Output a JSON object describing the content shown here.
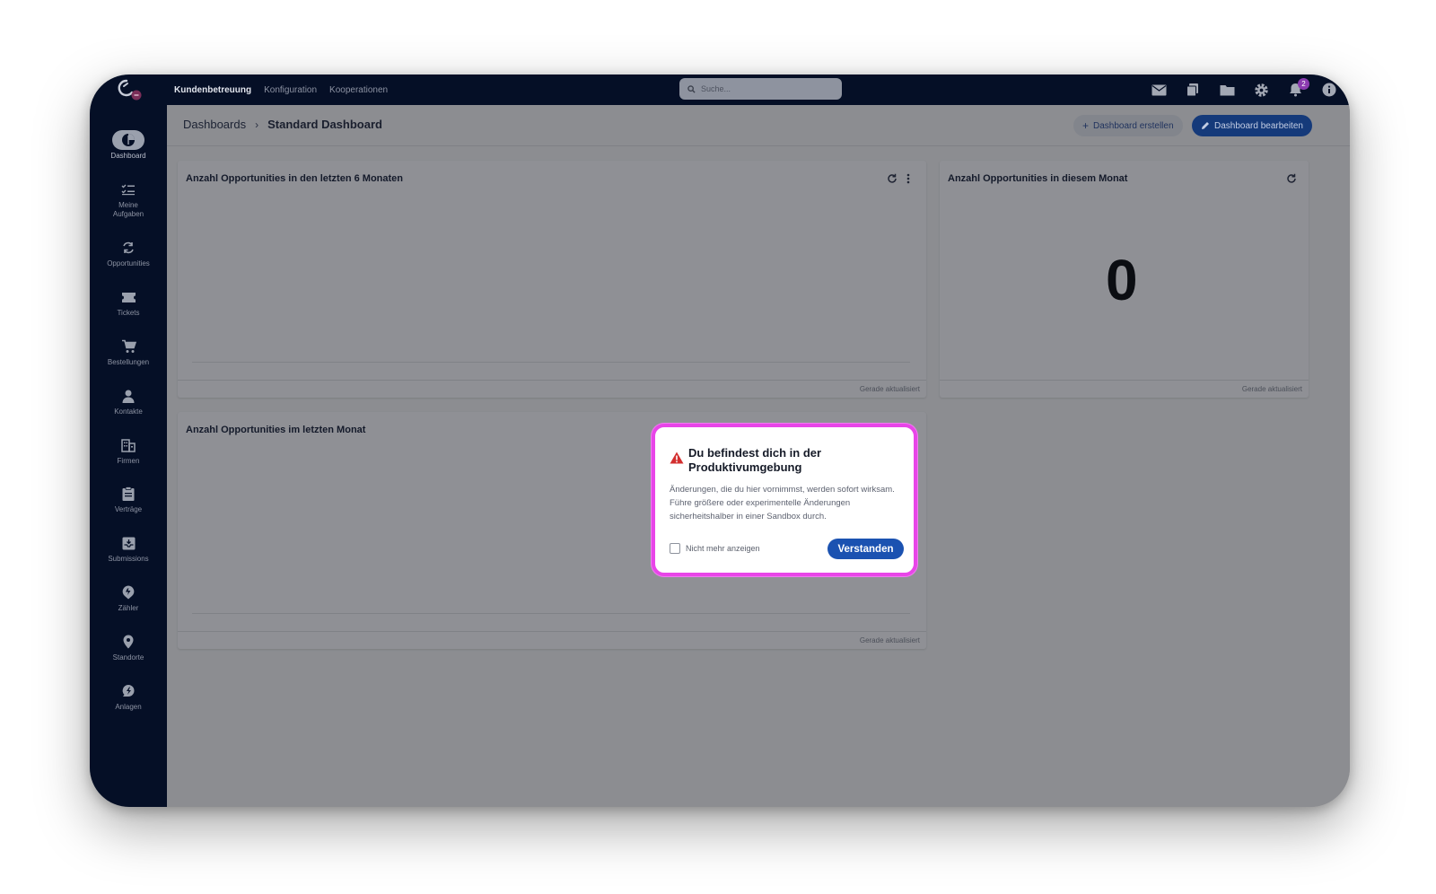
{
  "topnav": {
    "items": [
      {
        "label": "Kundenbetreuung",
        "active": true
      },
      {
        "label": "Konfiguration",
        "active": false
      },
      {
        "label": "Kooperationen",
        "active": false
      }
    ],
    "search_placeholder": "Suche...",
    "icons": [
      "mail-icon",
      "document-stack-icon",
      "folder-icon",
      "gear-icon",
      "bell-icon",
      "info-icon"
    ],
    "notification_count": "2"
  },
  "sidebar": {
    "items": [
      {
        "label": "Dashboard",
        "icon": "dashboard-icon",
        "active": true
      },
      {
        "label": "Meine Aufgaben",
        "icon": "checklist-icon"
      },
      {
        "label": "Opportunities",
        "icon": "refresh-arrows-icon"
      },
      {
        "label": "Tickets",
        "icon": "ticket-icon"
      },
      {
        "label": "Bestellungen",
        "icon": "cart-icon"
      },
      {
        "label": "Kontakte",
        "icon": "person-icon"
      },
      {
        "label": "Firmen",
        "icon": "building-icon"
      },
      {
        "label": "Verträge",
        "icon": "clipboard-icon"
      },
      {
        "label": "Submissions",
        "icon": "inbox-icon"
      },
      {
        "label": "Zähler",
        "icon": "meter-icon"
      },
      {
        "label": "Standorte",
        "icon": "location-pin-icon"
      },
      {
        "label": "Anlagen",
        "icon": "plant-icon"
      }
    ]
  },
  "header": {
    "breadcrumb_root": "Dashboards",
    "breadcrumb_current": "Standard Dashboard",
    "create_button": "Dashboard erstellen",
    "edit_button": "Dashboard bearbeiten"
  },
  "cards": {
    "six_months": {
      "title": "Anzahl Opportunities in den letzten 6 Monaten",
      "footer": "Gerade aktualisiert"
    },
    "this_month": {
      "title": "Anzahl Opportunities in diesem Monat",
      "value": "0",
      "footer": "Gerade aktualisiert"
    },
    "last_month": {
      "title": "Anzahl Opportunities im letzten Monat",
      "footer": "Gerade aktualisiert"
    }
  },
  "modal": {
    "title": "Du befindest dich in der Produktivumgebung",
    "body": "Änderungen, die du hier vornimmst, werden sofort wirksam. Führe größere oder experimentelle Änderungen sicherheitshalber in einer Sandbox durch.",
    "checkbox_label": "Nicht mehr anzeigen",
    "confirm_button": "Verstanden"
  },
  "colors": {
    "nav_bg": "#050f26",
    "primary": "#1b52b1",
    "highlight": "#e845e8",
    "warning": "#d32f2f"
  }
}
